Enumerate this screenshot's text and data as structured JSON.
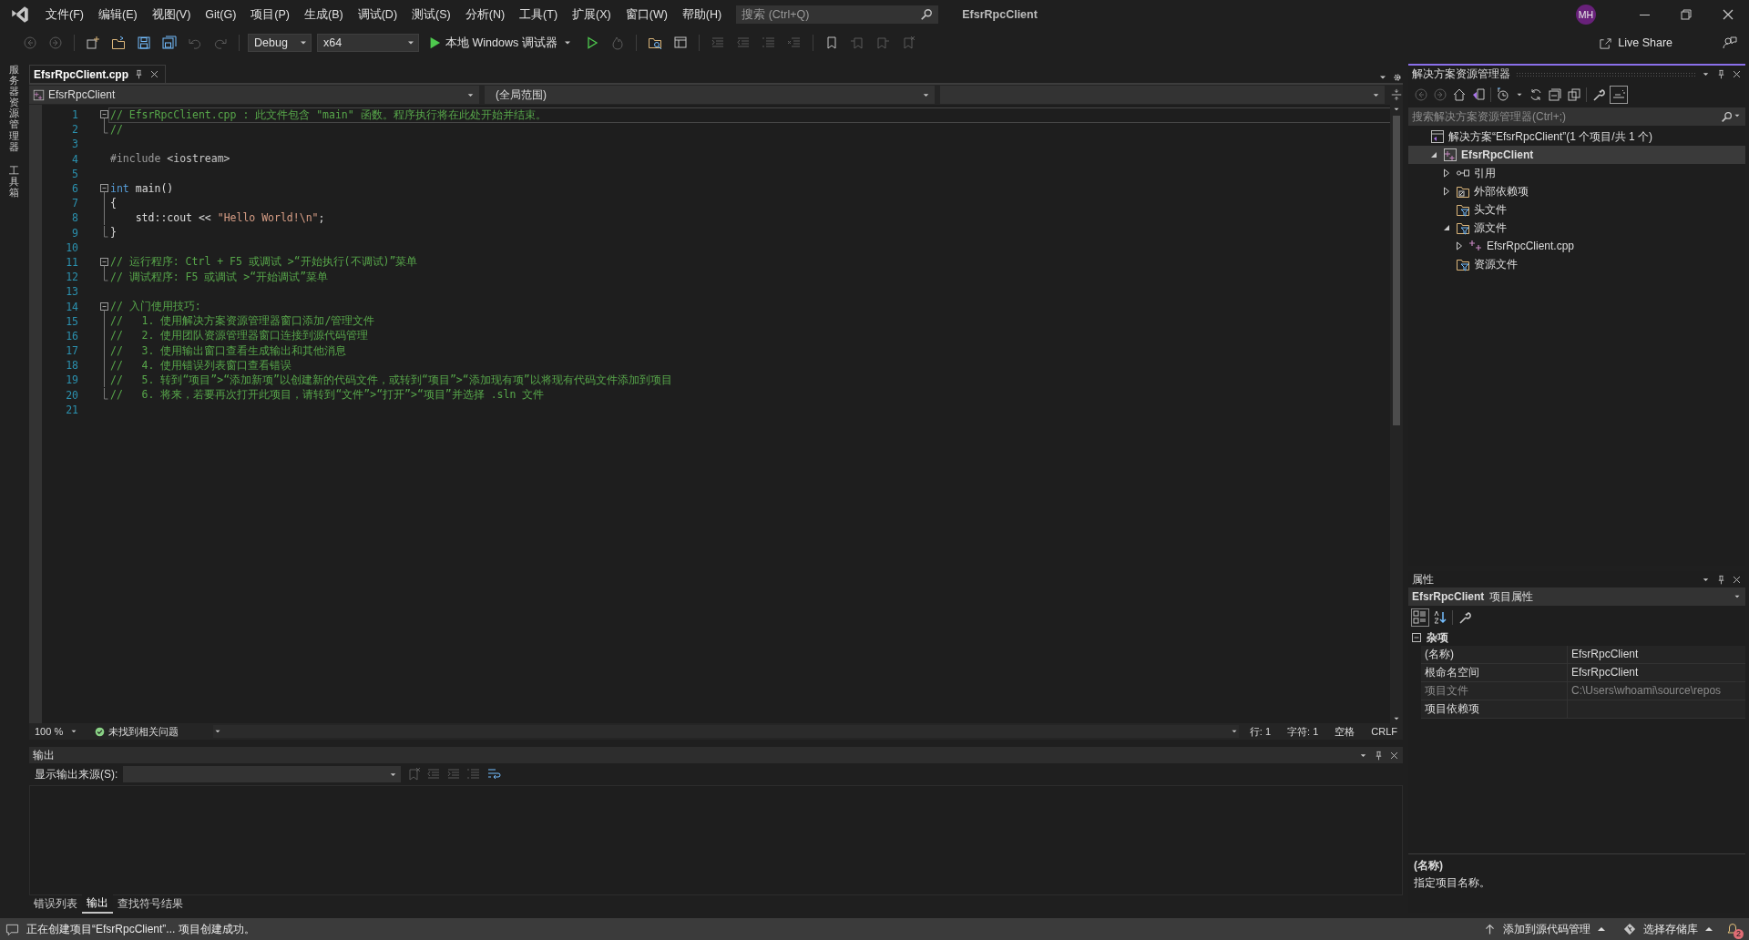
{
  "menu_bar": {
    "items": [
      "文件(F)",
      "编辑(E)",
      "视图(V)",
      "Git(G)",
      "项目(P)",
      "生成(B)",
      "调试(D)",
      "测试(S)",
      "分析(N)",
      "工具(T)",
      "扩展(X)",
      "窗口(W)",
      "帮助(H)"
    ],
    "search": {
      "placeholder": "搜索 (Ctrl+Q)"
    },
    "title": "EfsrRpcClient",
    "avatar": "MH"
  },
  "toolbar": {
    "left_icons": [
      {
        "kind": "back",
        "disabled": true
      },
      {
        "kind": "forward",
        "disabled": true
      },
      {
        "kind": "new-project",
        "disabled": false
      },
      {
        "kind": "open-folder",
        "disabled": false
      },
      {
        "kind": "save",
        "disabled": false
      },
      {
        "kind": "save-all",
        "disabled": false
      },
      {
        "kind": "undo",
        "disabled": true
      },
      {
        "kind": "redo",
        "disabled": true
      }
    ],
    "configuration": "Debug",
    "platform": "x64",
    "start": "本地 Windows 调试器",
    "right_icons": [
      {
        "kind": "run-without-debug",
        "disabled": false
      },
      {
        "kind": "hot-reload",
        "disabled": true
      },
      {
        "kind": "folder-search",
        "disabled": false
      },
      {
        "kind": "layout",
        "disabled": false
      },
      {
        "kind": "indent",
        "disabled": true
      },
      {
        "kind": "outdent",
        "disabled": true
      },
      {
        "kind": "comment",
        "disabled": true
      },
      {
        "kind": "uncomment",
        "disabled": true
      },
      {
        "kind": "bookmark",
        "disabled": false
      },
      {
        "kind": "bookmark-prev",
        "disabled": true
      },
      {
        "kind": "bookmark-next",
        "disabled": true
      },
      {
        "kind": "bookmark-clear",
        "disabled": true
      }
    ],
    "live_share": "Live Share"
  },
  "side_strip": [
    "服务器资源管理器",
    "工具箱"
  ],
  "editor": {
    "tabs": [
      {
        "label": "EfsrRpcClient.cpp",
        "selected": true
      }
    ],
    "nav": {
      "project": "EfsrRpcClient",
      "scope": "(全局范围)"
    },
    "lines": [
      {
        "number": "1",
        "kind": "fold-start",
        "current": true,
        "tokens": [
          {
            "kind": "comment",
            "text": "// EfsrRpcClient.cpp : 此文件包含 \"main\" 函数。程序执行将在此处开始并结束。"
          }
        ]
      },
      {
        "number": "2",
        "kind": "fold-end",
        "current": false,
        "tokens": [
          {
            "kind": "comment",
            "text": "//"
          }
        ]
      },
      {
        "number": "3",
        "kind": "plain",
        "current": false
      },
      {
        "number": "4",
        "kind": "plain",
        "current": false,
        "tokens": [
          {
            "kind": "preprocessor",
            "text": "#include "
          },
          {
            "kind": "include",
            "text": "<iostream>"
          }
        ]
      },
      {
        "number": "5",
        "kind": "plain",
        "current": false
      },
      {
        "number": "6",
        "kind": "fold-start",
        "current": false,
        "tokens": [
          {
            "kind": "keyword",
            "text": "int"
          },
          {
            "kind": "plain",
            "text": " main()"
          }
        ]
      },
      {
        "number": "7",
        "kind": "fold-inside",
        "current": false,
        "tokens": [
          {
            "kind": "plain",
            "text": "{"
          }
        ]
      },
      {
        "number": "8",
        "kind": "fold-inside",
        "current": false,
        "tokens": [
          {
            "kind": "plain",
            "text": "    std::cout << "
          },
          {
            "kind": "string",
            "text": "\"Hello World!\\n\""
          },
          {
            "kind": "plain",
            "text": ";"
          }
        ]
      },
      {
        "number": "9",
        "kind": "fold-end",
        "current": false,
        "tokens": [
          {
            "kind": "plain",
            "text": "}"
          }
        ]
      },
      {
        "number": "10",
        "kind": "plain",
        "current": false
      },
      {
        "number": "11",
        "kind": "fold-start",
        "current": false,
        "tokens": [
          {
            "kind": "comment",
            "text": "// 运行程序: Ctrl + F5 或调试 >“开始执行(不调试)”菜单"
          }
        ]
      },
      {
        "number": "12",
        "kind": "fold-end",
        "current": false,
        "tokens": [
          {
            "kind": "comment",
            "text": "// 调试程序: F5 或调试 >“开始调试”菜单"
          }
        ]
      },
      {
        "number": "13",
        "kind": "plain",
        "current": false
      },
      {
        "number": "14",
        "kind": "fold-start",
        "current": false,
        "tokens": [
          {
            "kind": "comment",
            "text": "// 入门使用技巧: "
          }
        ]
      },
      {
        "number": "15",
        "kind": "fold-inside",
        "current": false,
        "tokens": [
          {
            "kind": "comment",
            "text": "//   1. 使用解决方案资源管理器窗口添加/管理文件"
          }
        ]
      },
      {
        "number": "16",
        "kind": "fold-inside",
        "current": false,
        "tokens": [
          {
            "kind": "comment",
            "text": "//   2. 使用团队资源管理器窗口连接到源代码管理"
          }
        ]
      },
      {
        "number": "17",
        "kind": "fold-inside",
        "current": false,
        "tokens": [
          {
            "kind": "comment",
            "text": "//   3. 使用输出窗口查看生成输出和其他消息"
          }
        ]
      },
      {
        "number": "18",
        "kind": "fold-inside",
        "current": false,
        "tokens": [
          {
            "kind": "comment",
            "text": "//   4. 使用错误列表窗口查看错误"
          }
        ]
      },
      {
        "number": "19",
        "kind": "fold-inside",
        "current": false,
        "tokens": [
          {
            "kind": "comment",
            "text": "//   5. 转到“项目”>“添加新项”以创建新的代码文件，或转到“项目”>“添加现有项”以将现有代码文件添加到项目"
          }
        ]
      },
      {
        "number": "20",
        "kind": "fold-end",
        "current": false,
        "tokens": [
          {
            "kind": "comment",
            "text": "//   6. 将来，若要再次打开此项目，请转到“文件”>“打开”>“项目”并选择 .sln 文件"
          }
        ]
      },
      {
        "number": "21",
        "kind": "plain",
        "current": false
      }
    ],
    "zoom": "100 %",
    "issues": "未找到相关问题",
    "line": "行: 1",
    "char": "字符: 1",
    "whitespace": "空格",
    "line_ending": "CRLF"
  },
  "output": {
    "title": "输出",
    "source_label": "显示输出来源(S):",
    "tabs": [
      {
        "label": "错误列表",
        "selected": false
      },
      {
        "label": "输出",
        "selected": true
      },
      {
        "label": "查找符号结果",
        "selected": false
      }
    ]
  },
  "solution_explorer": {
    "title": "解决方案资源管理器",
    "search": {
      "placeholder": "搜索解决方案资源管理器(Ctrl+;)"
    },
    "tree": [
      {
        "label": "解决方案“EfsrRpcClient”(1 个项目/共 1 个)",
        "kind": "solution",
        "selected": false,
        "children": [
          {
            "label": "EfsrRpcClient",
            "kind": "project",
            "selected": true,
            "expanded": true,
            "children": [
              {
                "label": "引用",
                "kind": "references",
                "selected": false,
                "expanded": false
              },
              {
                "label": "外部依赖项",
                "kind": "external",
                "selected": false,
                "expanded": false
              },
              {
                "label": "头文件",
                "kind": "filter",
                "selected": false
              },
              {
                "label": "源文件",
                "kind": "filter",
                "selected": false,
                "expanded": true,
                "children": [
                  {
                    "label": "EfsrRpcClient.cpp",
                    "kind": "cpp",
                    "selected": false,
                    "expanded": false
                  }
                ]
              },
              {
                "label": "资源文件",
                "kind": "filter",
                "selected": false
              }
            ]
          }
        ]
      }
    ]
  },
  "properties": {
    "title": "属性",
    "object": "EfsrRpcClient",
    "object_type": "项目属性",
    "category": "杂项",
    "rows": [
      {
        "name": "(名称)",
        "value": "EfsrRpcClient",
        "disabled": false
      },
      {
        "name": "根命名空间",
        "value": "EfsrRpcClient",
        "disabled": false
      },
      {
        "name": "项目文件",
        "value": "C:\\Users\\whoami\\source\\repos",
        "disabled": true
      },
      {
        "name": "项目依赖项",
        "disabled": false
      }
    ],
    "description": {
      "title": "(名称)",
      "text": "指定项目名称。"
    }
  },
  "status_bar": {
    "message": "正在创建项目“EfsrRpcClient”... 项目创建成功。",
    "source_control": "添加到源代码管理",
    "repository": "选择存储库",
    "notifications": "2"
  }
}
